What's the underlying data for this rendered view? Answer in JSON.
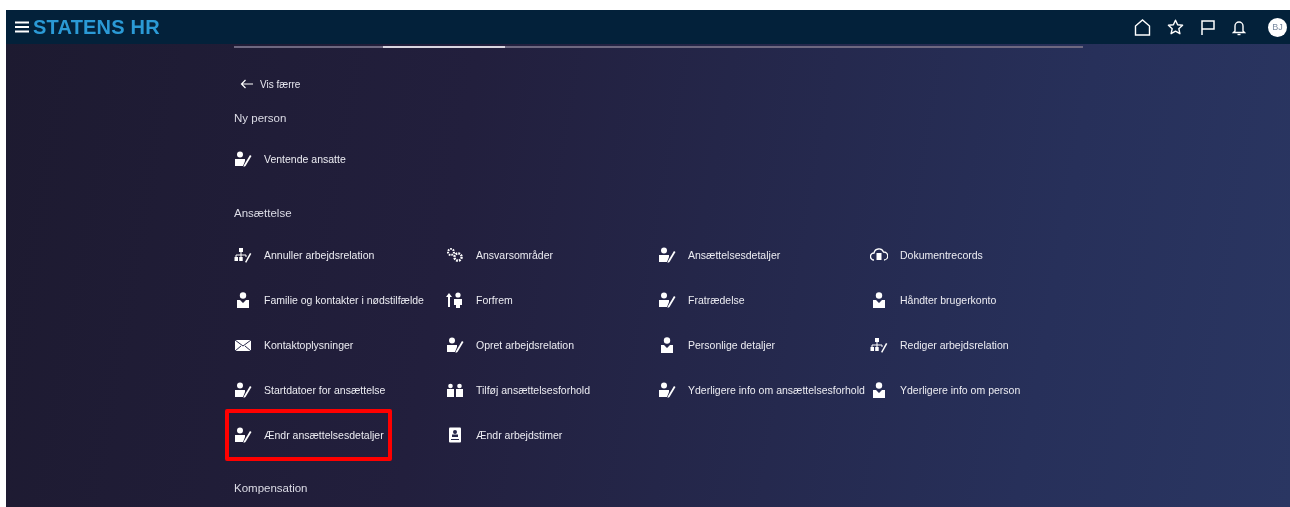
{
  "header": {
    "title": "STATENS HR",
    "avatar": "BJ"
  },
  "back_link": {
    "label": "Vis færre"
  },
  "sections": [
    {
      "heading": "Ny person",
      "items": [
        {
          "label": "Ventende ansatte",
          "kind": "person-edit",
          "highlighted": false
        }
      ]
    },
    {
      "heading": "Ansættelse",
      "items": [
        {
          "label": "Annuller arbejdsrelation",
          "kind": "org-edit",
          "highlighted": false
        },
        {
          "label": "Ansvarsområder",
          "kind": "gears",
          "highlighted": false
        },
        {
          "label": "Ansættelsesdetaljer",
          "kind": "person-edit",
          "highlighted": false
        },
        {
          "label": "Dokumentrecords",
          "kind": "cloud-doc",
          "highlighted": false
        },
        {
          "label": "Familie og kontakter i nødstilfælde",
          "kind": "person",
          "highlighted": false
        },
        {
          "label": "Forfrem",
          "kind": "promote",
          "highlighted": false
        },
        {
          "label": "Fratrædelse",
          "kind": "person-edit",
          "highlighted": false
        },
        {
          "label": "Håndter brugerkonto",
          "kind": "person",
          "highlighted": false
        },
        {
          "label": "Kontaktoplysninger",
          "kind": "mail",
          "highlighted": false
        },
        {
          "label": "Opret arbejdsrelation",
          "kind": "person-edit",
          "highlighted": false
        },
        {
          "label": "Personlige detaljer",
          "kind": "person",
          "highlighted": false
        },
        {
          "label": "Rediger arbejdsrelation",
          "kind": "org-edit",
          "highlighted": false
        },
        {
          "label": "Startdatoer for ansættelse",
          "kind": "person-edit",
          "highlighted": false
        },
        {
          "label": "Tilføj ansættelsesforhold",
          "kind": "people",
          "highlighted": false
        },
        {
          "label": "Yderligere info om ansættelsesforhold",
          "kind": "person-edit",
          "highlighted": false
        },
        {
          "label": "Yderligere info om person",
          "kind": "person",
          "highlighted": false
        },
        {
          "label": "Ændr ansættelsesdetaljer",
          "kind": "person-edit",
          "highlighted": true
        },
        {
          "label": "Ændr arbejdstimer",
          "kind": "badge",
          "highlighted": false
        }
      ]
    },
    {
      "heading": "Kompensation"
    }
  ]
}
